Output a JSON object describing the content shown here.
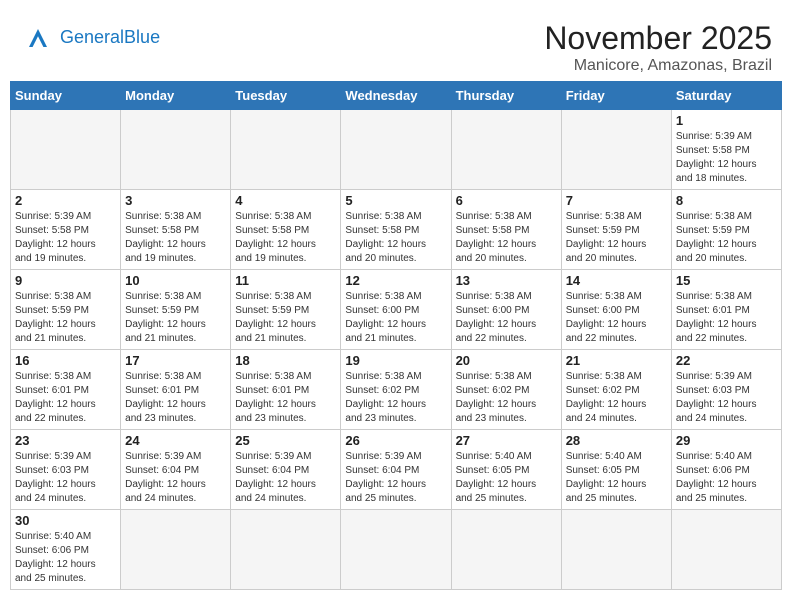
{
  "header": {
    "logo_general": "General",
    "logo_blue": "Blue",
    "title": "November 2025",
    "subtitle": "Manicore, Amazonas, Brazil"
  },
  "weekdays": [
    "Sunday",
    "Monday",
    "Tuesday",
    "Wednesday",
    "Thursday",
    "Friday",
    "Saturday"
  ],
  "weeks": [
    [
      {
        "day": "",
        "info": ""
      },
      {
        "day": "",
        "info": ""
      },
      {
        "day": "",
        "info": ""
      },
      {
        "day": "",
        "info": ""
      },
      {
        "day": "",
        "info": ""
      },
      {
        "day": "",
        "info": ""
      },
      {
        "day": "1",
        "info": "Sunrise: 5:39 AM\nSunset: 5:58 PM\nDaylight: 12 hours\nand 18 minutes."
      }
    ],
    [
      {
        "day": "2",
        "info": "Sunrise: 5:39 AM\nSunset: 5:58 PM\nDaylight: 12 hours\nand 19 minutes."
      },
      {
        "day": "3",
        "info": "Sunrise: 5:38 AM\nSunset: 5:58 PM\nDaylight: 12 hours\nand 19 minutes."
      },
      {
        "day": "4",
        "info": "Sunrise: 5:38 AM\nSunset: 5:58 PM\nDaylight: 12 hours\nand 19 minutes."
      },
      {
        "day": "5",
        "info": "Sunrise: 5:38 AM\nSunset: 5:58 PM\nDaylight: 12 hours\nand 20 minutes."
      },
      {
        "day": "6",
        "info": "Sunrise: 5:38 AM\nSunset: 5:58 PM\nDaylight: 12 hours\nand 20 minutes."
      },
      {
        "day": "7",
        "info": "Sunrise: 5:38 AM\nSunset: 5:59 PM\nDaylight: 12 hours\nand 20 minutes."
      },
      {
        "day": "8",
        "info": "Sunrise: 5:38 AM\nSunset: 5:59 PM\nDaylight: 12 hours\nand 20 minutes."
      }
    ],
    [
      {
        "day": "9",
        "info": "Sunrise: 5:38 AM\nSunset: 5:59 PM\nDaylight: 12 hours\nand 21 minutes."
      },
      {
        "day": "10",
        "info": "Sunrise: 5:38 AM\nSunset: 5:59 PM\nDaylight: 12 hours\nand 21 minutes."
      },
      {
        "day": "11",
        "info": "Sunrise: 5:38 AM\nSunset: 5:59 PM\nDaylight: 12 hours\nand 21 minutes."
      },
      {
        "day": "12",
        "info": "Sunrise: 5:38 AM\nSunset: 6:00 PM\nDaylight: 12 hours\nand 21 minutes."
      },
      {
        "day": "13",
        "info": "Sunrise: 5:38 AM\nSunset: 6:00 PM\nDaylight: 12 hours\nand 22 minutes."
      },
      {
        "day": "14",
        "info": "Sunrise: 5:38 AM\nSunset: 6:00 PM\nDaylight: 12 hours\nand 22 minutes."
      },
      {
        "day": "15",
        "info": "Sunrise: 5:38 AM\nSunset: 6:01 PM\nDaylight: 12 hours\nand 22 minutes."
      }
    ],
    [
      {
        "day": "16",
        "info": "Sunrise: 5:38 AM\nSunset: 6:01 PM\nDaylight: 12 hours\nand 22 minutes."
      },
      {
        "day": "17",
        "info": "Sunrise: 5:38 AM\nSunset: 6:01 PM\nDaylight: 12 hours\nand 23 minutes."
      },
      {
        "day": "18",
        "info": "Sunrise: 5:38 AM\nSunset: 6:01 PM\nDaylight: 12 hours\nand 23 minutes."
      },
      {
        "day": "19",
        "info": "Sunrise: 5:38 AM\nSunset: 6:02 PM\nDaylight: 12 hours\nand 23 minutes."
      },
      {
        "day": "20",
        "info": "Sunrise: 5:38 AM\nSunset: 6:02 PM\nDaylight: 12 hours\nand 23 minutes."
      },
      {
        "day": "21",
        "info": "Sunrise: 5:38 AM\nSunset: 6:02 PM\nDaylight: 12 hours\nand 24 minutes."
      },
      {
        "day": "22",
        "info": "Sunrise: 5:39 AM\nSunset: 6:03 PM\nDaylight: 12 hours\nand 24 minutes."
      }
    ],
    [
      {
        "day": "23",
        "info": "Sunrise: 5:39 AM\nSunset: 6:03 PM\nDaylight: 12 hours\nand 24 minutes."
      },
      {
        "day": "24",
        "info": "Sunrise: 5:39 AM\nSunset: 6:04 PM\nDaylight: 12 hours\nand 24 minutes."
      },
      {
        "day": "25",
        "info": "Sunrise: 5:39 AM\nSunset: 6:04 PM\nDaylight: 12 hours\nand 24 minutes."
      },
      {
        "day": "26",
        "info": "Sunrise: 5:39 AM\nSunset: 6:04 PM\nDaylight: 12 hours\nand 25 minutes."
      },
      {
        "day": "27",
        "info": "Sunrise: 5:40 AM\nSunset: 6:05 PM\nDaylight: 12 hours\nand 25 minutes."
      },
      {
        "day": "28",
        "info": "Sunrise: 5:40 AM\nSunset: 6:05 PM\nDaylight: 12 hours\nand 25 minutes."
      },
      {
        "day": "29",
        "info": "Sunrise: 5:40 AM\nSunset: 6:06 PM\nDaylight: 12 hours\nand 25 minutes."
      }
    ],
    [
      {
        "day": "30",
        "info": "Sunrise: 5:40 AM\nSunset: 6:06 PM\nDaylight: 12 hours\nand 25 minutes."
      },
      {
        "day": "",
        "info": ""
      },
      {
        "day": "",
        "info": ""
      },
      {
        "day": "",
        "info": ""
      },
      {
        "day": "",
        "info": ""
      },
      {
        "day": "",
        "info": ""
      },
      {
        "day": "",
        "info": ""
      }
    ]
  ]
}
